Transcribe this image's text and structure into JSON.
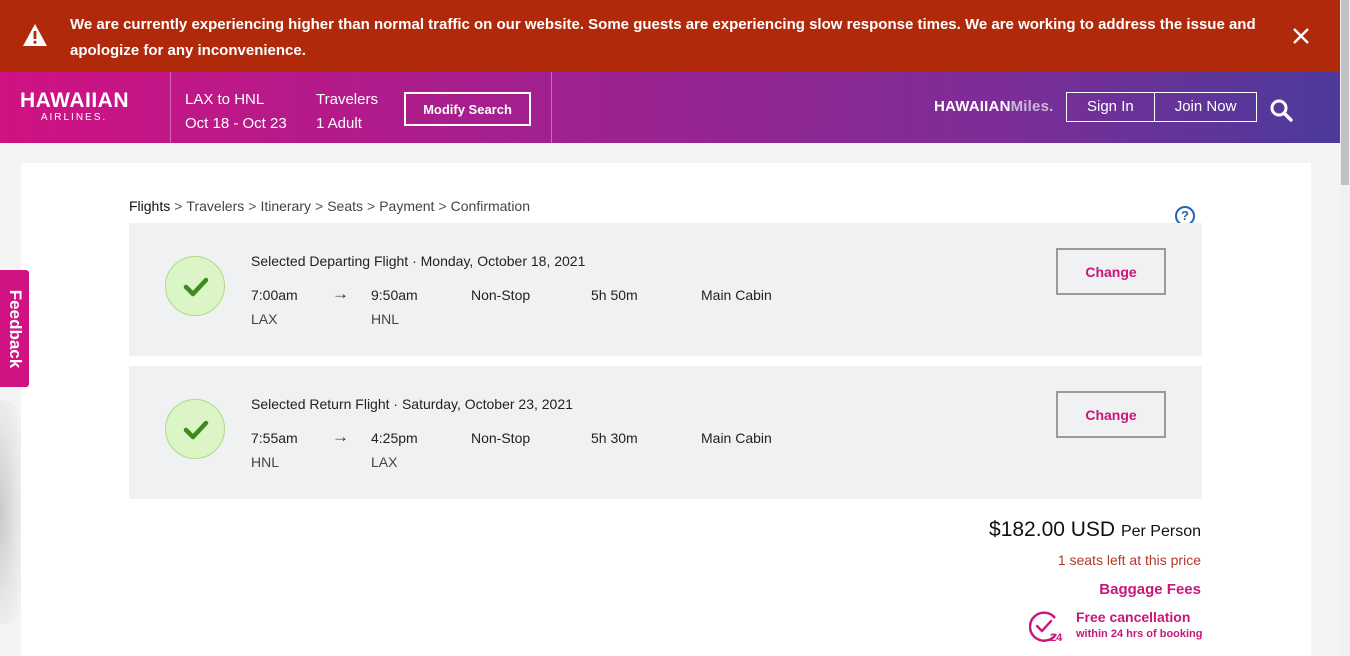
{
  "alert": {
    "message": "We are currently experiencing higher than normal traffic on our website. Some guests are experiencing slow response times. We are working to address the issue and apologize for any inconvenience."
  },
  "header": {
    "logo_main": "HAWAIIAN",
    "logo_sub": "AIRLINES.",
    "route": "LAX to HNL",
    "dates": "Oct 18 - Oct 23",
    "travelers_label": "Travelers",
    "travelers_value": "1 Adult",
    "modify_label": "Modify Search",
    "miles_part1": "HAWAIIAN",
    "miles_part2": "Miles.",
    "sign_in": "Sign In",
    "join_now": "Join Now"
  },
  "feedback": "Feedback",
  "breadcrumb": [
    "Flights",
    "Travelers",
    "Itinerary",
    "Seats",
    "Payment",
    "Confirmation"
  ],
  "help": "?",
  "flights": [
    {
      "title": "Selected Departing Flight · Monday, October 18, 2021",
      "depart_time": "7:00am",
      "arrow": "→",
      "arrive_time": "9:50am",
      "stops": "Non-Stop",
      "duration": "5h 50m",
      "cabin": "Main Cabin",
      "from": "LAX",
      "to": "HNL",
      "change_label": "Change"
    },
    {
      "title": "Selected Return Flight · Saturday, October 23, 2021",
      "depart_time": "7:55am",
      "arrow": "→",
      "arrive_time": "4:25pm",
      "stops": "Non-Stop",
      "duration": "5h 30m",
      "cabin": "Main Cabin",
      "from": "HNL",
      "to": "LAX",
      "change_label": "Change"
    }
  ],
  "pricing": {
    "amount": "$182.00 USD",
    "per": "Per Person",
    "seats_left": "1 seats left at this price",
    "baggage": "Baggage Fees",
    "free_cancel_title": "Free cancellation",
    "free_cancel_sub": "within 24 hrs of booking",
    "free_cancel_badge": "24"
  },
  "colors": {
    "alert_bg": "#b0290b",
    "brand_magenta": "#c8167a",
    "header_gradient_end": "#4c3a9a",
    "check_bg": "#dcf5c7",
    "check_mark": "#3d8a1f"
  }
}
